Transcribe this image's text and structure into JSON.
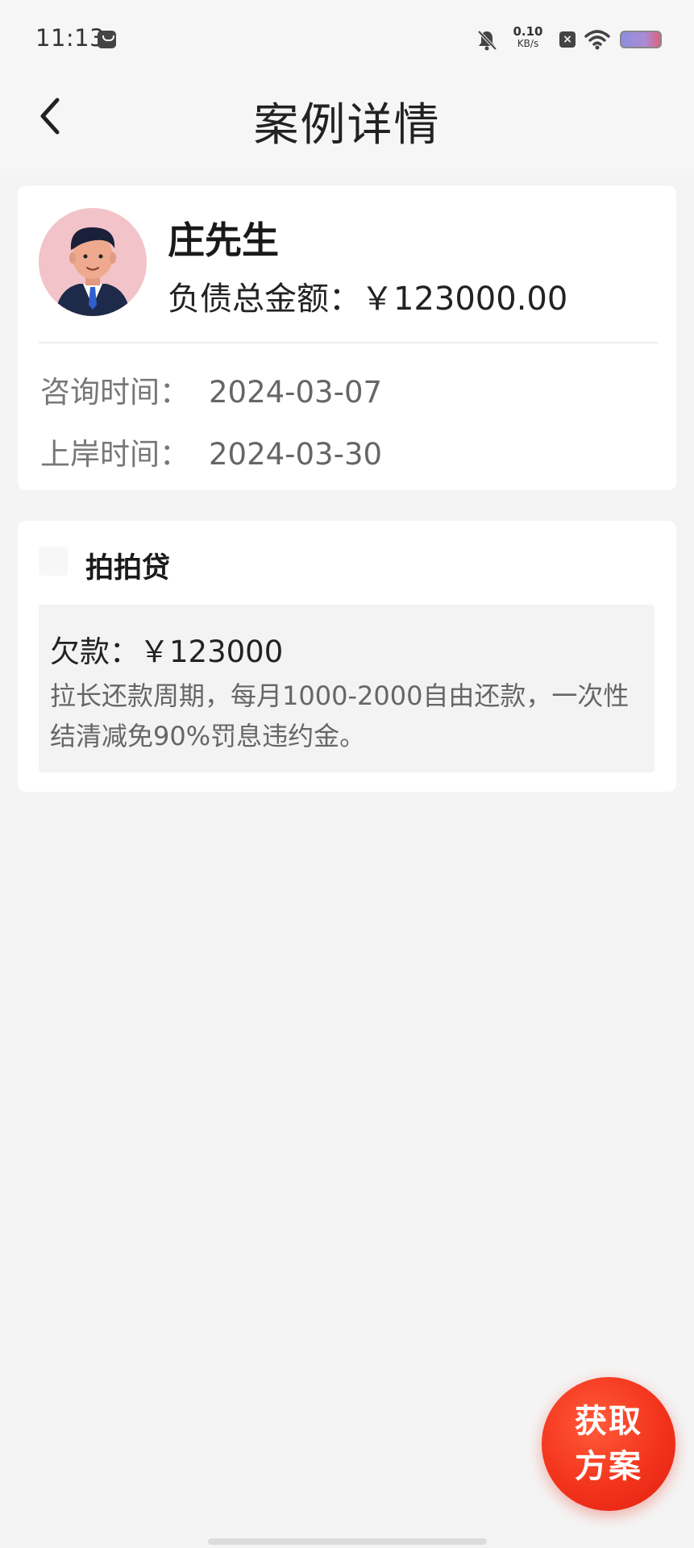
{
  "status_bar": {
    "time": "11:13",
    "net_speed_value": "0.10",
    "net_speed_unit": "KB/s",
    "icons": [
      "message-icon",
      "mute-bell-icon",
      "close-box-icon",
      "wifi-icon",
      "battery-icon"
    ]
  },
  "header": {
    "title": "案例详情",
    "back_icon": "chevron-left-icon"
  },
  "profile": {
    "name": "庄先生",
    "debt_label": "负债总金额：",
    "debt_amount": "￥123000.00",
    "consult_label": "咨询时间：",
    "consult_date": "2024-03-07",
    "landing_label": "上岸时间：",
    "landing_date": "2024-03-30"
  },
  "loan": {
    "platform_name": "拍拍贷",
    "amount_label": "欠款：",
    "amount": "￥123000",
    "description": "拉长还款周期，每月1000-2000自由还款，一次性结清减免90%罚息违约金。"
  },
  "fab": {
    "line1": "获取",
    "line2": "方案",
    "color": "#f3341c"
  }
}
